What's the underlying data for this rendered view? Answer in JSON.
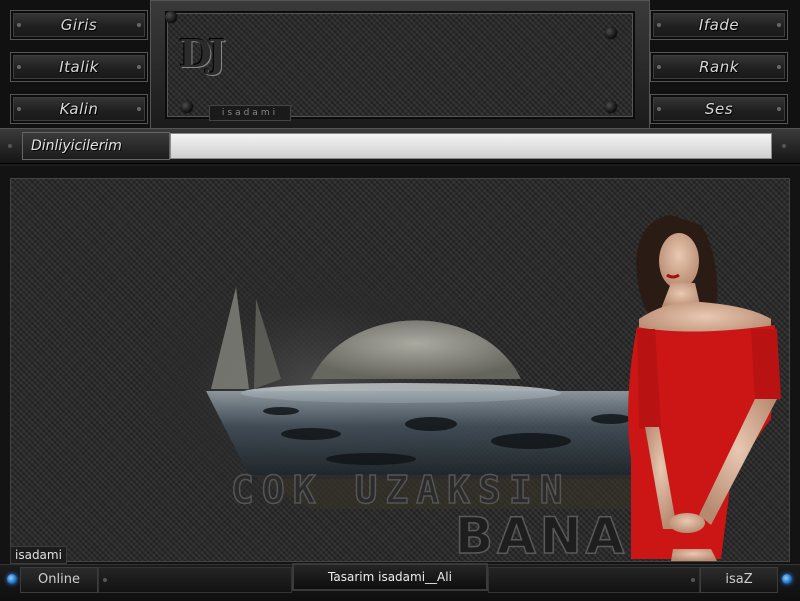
{
  "nav_left": [
    {
      "label": "Giris"
    },
    {
      "label": "Italik"
    },
    {
      "label": "Kalin"
    }
  ],
  "nav_right": [
    {
      "label": "Ifade"
    },
    {
      "label": "Rank"
    },
    {
      "label": "Ses"
    }
  ],
  "header": {
    "logo": "DJ",
    "logo_sub": "isadami"
  },
  "listeners": {
    "label": "Dinliyicilerim"
  },
  "banner": {
    "text_line1": "COK UZAKSIN",
    "text_line2": "BANA"
  },
  "user_tag": "isadami",
  "footer": {
    "online_label": "Online",
    "credit": "Tasarim  isadami__Ali",
    "right_label": "isaZ"
  },
  "colors": {
    "accent_blue": "#2a8cff",
    "dress_red": "#d11a1a"
  }
}
